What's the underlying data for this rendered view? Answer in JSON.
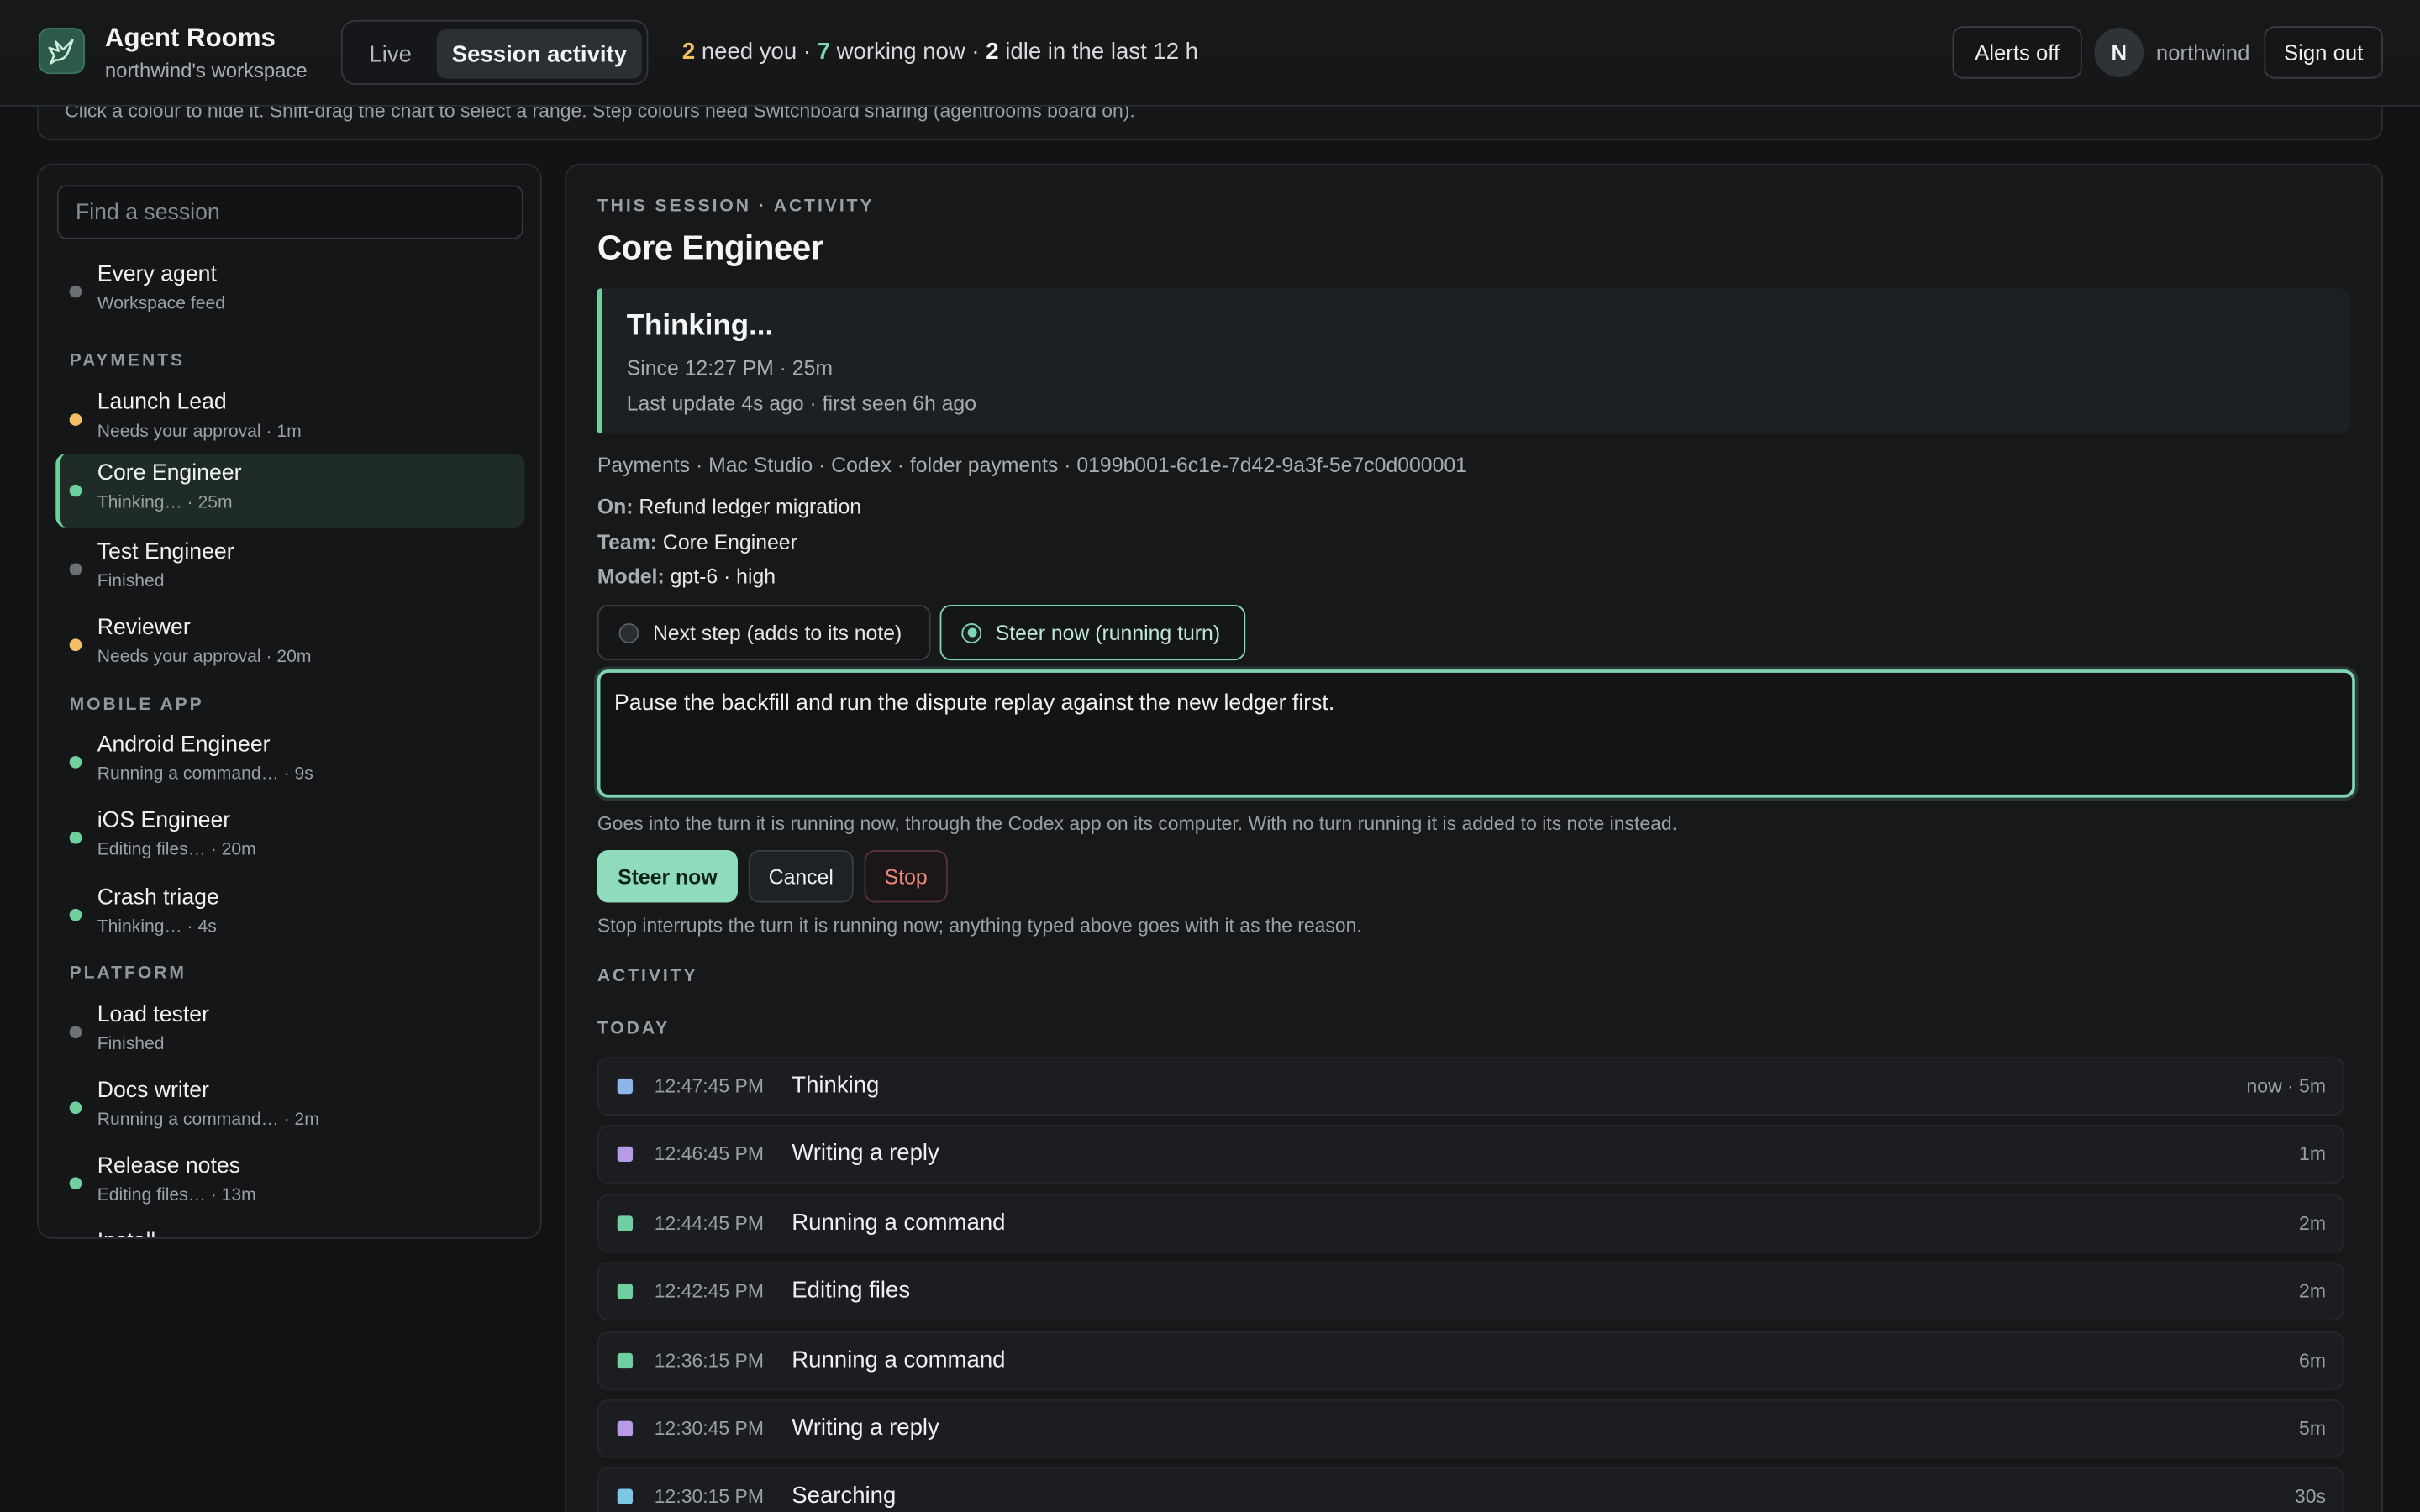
{
  "topbar": {
    "app_title": "Agent Rooms",
    "workspace": "northwind's workspace",
    "modes": {
      "live": "Live",
      "session": "Session activity"
    },
    "summary": {
      "need_count": "2",
      "need_text": " need you · ",
      "working_count": "7",
      "working_text": " working now · ",
      "idle_count": "2",
      "idle_text": " idle in the last 12 h"
    },
    "alerts_label": "Alerts off",
    "avatar_initial": "N",
    "username": "northwind",
    "signout_label": "Sign out"
  },
  "hint": "Click a colour to hide it. Shift-drag the chart to select a range. Step colours need Switchboard sharing (agentrooms board on).",
  "sidebar": {
    "search_placeholder": "Find a session",
    "all": {
      "name": "Every agent",
      "sub": "Workspace feed",
      "status": "grey"
    },
    "groups": [
      {
        "label": "PAYMENTS",
        "items": [
          {
            "name": "Launch Lead",
            "sub": "Needs your approval · 1m",
            "status": "amber"
          },
          {
            "name": "Core Engineer",
            "sub": "Thinking… · 25m",
            "status": "green",
            "active": true
          },
          {
            "name": "Test Engineer",
            "sub": "Finished",
            "status": "grey"
          },
          {
            "name": "Reviewer",
            "sub": "Needs your approval · 20m",
            "status": "amber"
          }
        ]
      },
      {
        "label": "MOBILE APP",
        "items": [
          {
            "name": "Android Engineer",
            "sub": "Running a command… · 9s",
            "status": "green"
          },
          {
            "name": "iOS Engineer",
            "sub": "Editing files… · 20m",
            "status": "green"
          },
          {
            "name": "Crash triage",
            "sub": "Thinking… · 4s",
            "status": "green"
          }
        ]
      },
      {
        "label": "PLATFORM",
        "items": [
          {
            "name": "Load tester",
            "sub": "Finished",
            "status": "grey"
          },
          {
            "name": "Docs writer",
            "sub": "Running a command… · 2m",
            "status": "green"
          },
          {
            "name": "Release notes",
            "sub": "Editing files… · 13m",
            "status": "green"
          }
        ]
      }
    ],
    "cut_item": "Install"
  },
  "session": {
    "eyebrow": "THIS SESSION · ACTIVITY",
    "title": "Core Engineer",
    "status": {
      "title": "Thinking...",
      "since": "Since 12:27 PM · 25m",
      "update": "Last update 4s ago · first seen 6h ago"
    },
    "meta": "Payments · Mac Studio · Codex · folder payments · 0199b001-6c1e-7d42-9a3f-5e7c0d000001",
    "on_label": "On:",
    "on_value": "Refund ledger migration",
    "team_label": "Team:",
    "team_value": "Core Engineer",
    "model_label": "Model:",
    "model_value": "gpt-6 · high",
    "radio_next": "Next step (adds to its note)",
    "radio_steer": "Steer now (running turn)",
    "steer_text": "Pause the backfill and run the dispute replay against the new ledger first.",
    "steer_hint": "Goes into the turn it is running now, through the Codex app on its computer. With no turn running it is added to its note instead.",
    "btn_steer": "Steer now",
    "btn_cancel": "Cancel",
    "btn_stop": "Stop",
    "stop_hint": "Stop interrupts the turn it is running now; anything typed above goes with it as the reason.",
    "activity_label": "ACTIVITY",
    "today_label": "TODAY",
    "activity": [
      {
        "time": "12:47:45 PM",
        "label": "Thinking",
        "dur": "now · 5m",
        "color": "#8fb6e8"
      },
      {
        "time": "12:46:45 PM",
        "label": "Writing a reply",
        "dur": "1m",
        "color": "#b79be8"
      },
      {
        "time": "12:44:45 PM",
        "label": "Running a command",
        "dur": "2m",
        "color": "#6fcf9f"
      },
      {
        "time": "12:42:45 PM",
        "label": "Editing files",
        "dur": "2m",
        "color": "#6fcf9f"
      },
      {
        "time": "12:36:15 PM",
        "label": "Running a command",
        "dur": "6m",
        "color": "#6fcf9f"
      },
      {
        "time": "12:30:45 PM",
        "label": "Writing a reply",
        "dur": "5m",
        "color": "#b79be8"
      },
      {
        "time": "12:30:15 PM",
        "label": "Searching",
        "dur": "30s",
        "color": "#7cc7e3"
      }
    ]
  },
  "colors": {
    "accent": "#7fd6b2",
    "amber": "#f0c063",
    "grey": "#6b7077",
    "stop": "#ef8a7a"
  }
}
